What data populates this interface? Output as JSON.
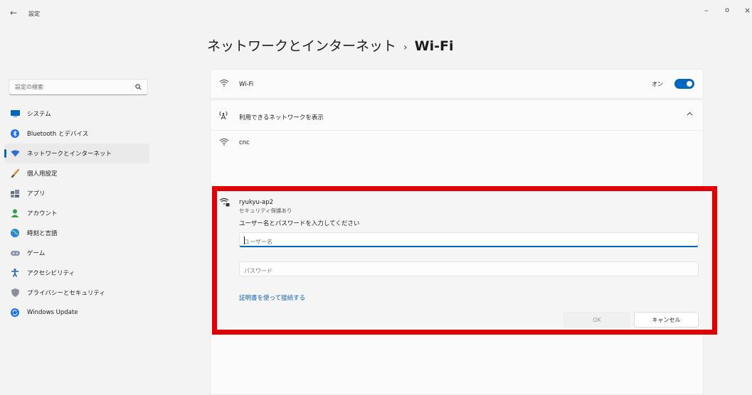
{
  "window": {
    "back_glyph": "←",
    "title": "設定",
    "min_glyph": "–",
    "max_glyph": "o",
    "close_glyph": "×"
  },
  "sidebar": {
    "search_placeholder": "設定の検索",
    "items": [
      {
        "label": "システム",
        "icon": "system-icon",
        "color": "#0067c0"
      },
      {
        "label": "Bluetooth とデバイス",
        "icon": "bluetooth-icon",
        "color": "#1a73e8"
      },
      {
        "label": "ネットワークとインターネット",
        "icon": "network-icon",
        "color": "#2b6fd0",
        "active": true
      },
      {
        "label": "個人用設定",
        "icon": "brush-icon",
        "color": "#c98a2b"
      },
      {
        "label": "アプリ",
        "icon": "apps-icon",
        "color": "#5a6b85"
      },
      {
        "label": "アカウント",
        "icon": "account-icon",
        "color": "#2ea043"
      },
      {
        "label": "時刻と言語",
        "icon": "globe-icon",
        "color": "#2b84d6"
      },
      {
        "label": "ゲーム",
        "icon": "gamepad-icon",
        "color": "#8a9ab0"
      },
      {
        "label": "アクセシビリティ",
        "icon": "accessibility-icon",
        "color": "#1f5fb8"
      },
      {
        "label": "プライバシーとセキュリティ",
        "icon": "shield-icon",
        "color": "#8a8f99"
      },
      {
        "label": "Windows Update",
        "icon": "update-icon",
        "color": "#1a73e8"
      }
    ]
  },
  "main": {
    "breadcrumb_parent": "ネットワークとインターネット",
    "breadcrumb_sep": "›",
    "breadcrumb_current": "Wi-Fi",
    "wifi_label": "Wi-Fi",
    "wifi_toggle_label": "オン",
    "wifi_on": true,
    "available_label": "利用できるネットワークを表示",
    "networks": [
      {
        "ssid": "cnc"
      }
    ],
    "selected_network": {
      "ssid": "ryukyu-ap2",
      "security": "セキュリティ保護あり",
      "prompt": "ユーザー名とパスワードを入力してください",
      "username_placeholder": "ユーザー名",
      "password_placeholder": "パスワード",
      "cert_link": "証明書を使って接続する",
      "ok_label": "OK",
      "cancel_label": "キャンセル"
    }
  },
  "annotation": {
    "highlight_color": "#e00000"
  }
}
